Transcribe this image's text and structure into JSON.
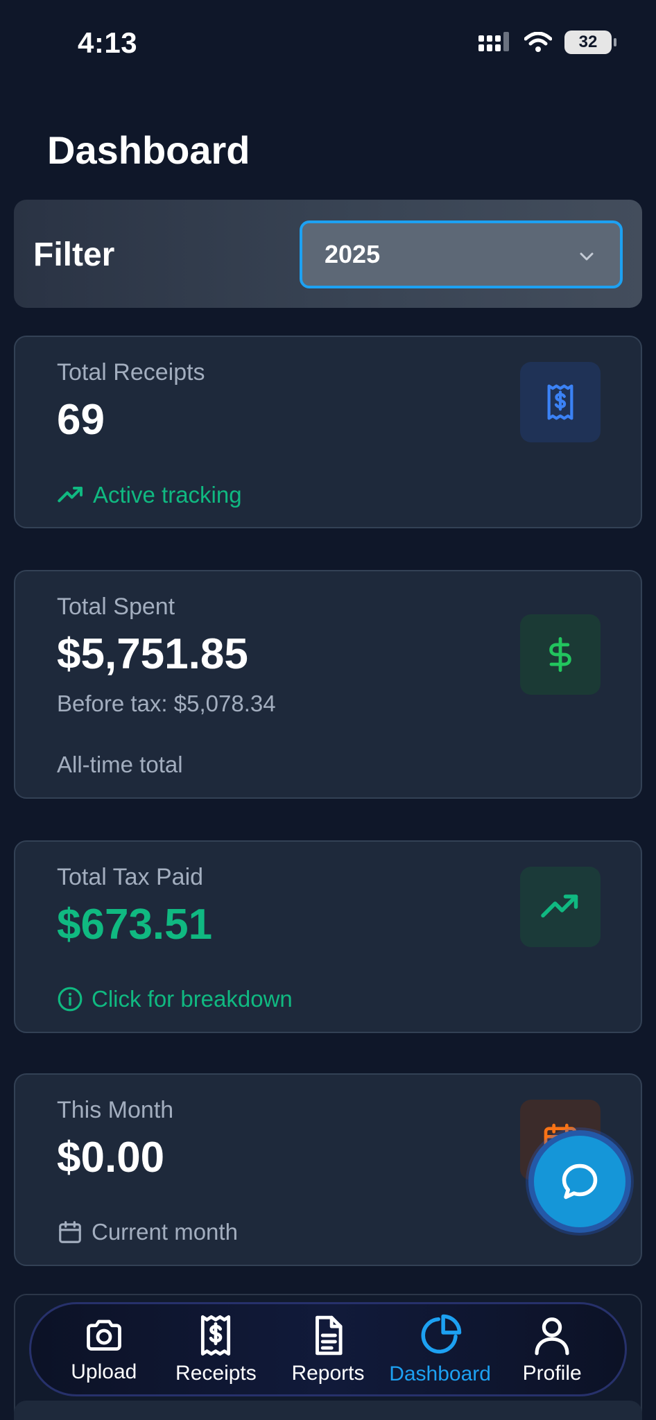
{
  "status_bar": {
    "time": "4:13",
    "battery": "32"
  },
  "page": {
    "title": "Dashboard"
  },
  "filter": {
    "label": "Filter",
    "selected": "2025"
  },
  "cards": [
    {
      "label": "Total Receipts",
      "value": "69",
      "footer": "Active tracking",
      "footer_color": "#10b981",
      "icon": "receipt-icon",
      "icon_color": "#3b82f6"
    },
    {
      "label": "Total Spent",
      "value": "$5,751.85",
      "sub": "Before tax: $5,078.34",
      "footer": "All-time total",
      "icon": "dollar-icon",
      "icon_color": "#22c55e"
    },
    {
      "label": "Total Tax Paid",
      "value": "$673.51",
      "value_color": "#10b981",
      "footer": "Click for breakdown",
      "footer_color": "#10b981",
      "icon": "trending-up-icon",
      "icon_color": "#10b981"
    },
    {
      "label": "This Month",
      "value": "$0.00",
      "footer": "Current month",
      "icon": "calendar-icon",
      "icon_color": "#f97316"
    }
  ],
  "nav": {
    "items": [
      {
        "label": "Upload",
        "icon": "camera-icon"
      },
      {
        "label": "Receipts",
        "icon": "receipt-icon"
      },
      {
        "label": "Reports",
        "icon": "document-icon"
      },
      {
        "label": "Dashboard",
        "icon": "pie-chart-icon",
        "active": true
      },
      {
        "label": "Profile",
        "icon": "user-icon"
      }
    ]
  },
  "colors": {
    "background": "#0f1729",
    "card": "#1e293b",
    "accent": "#1da1f2",
    "positive": "#10b981"
  }
}
